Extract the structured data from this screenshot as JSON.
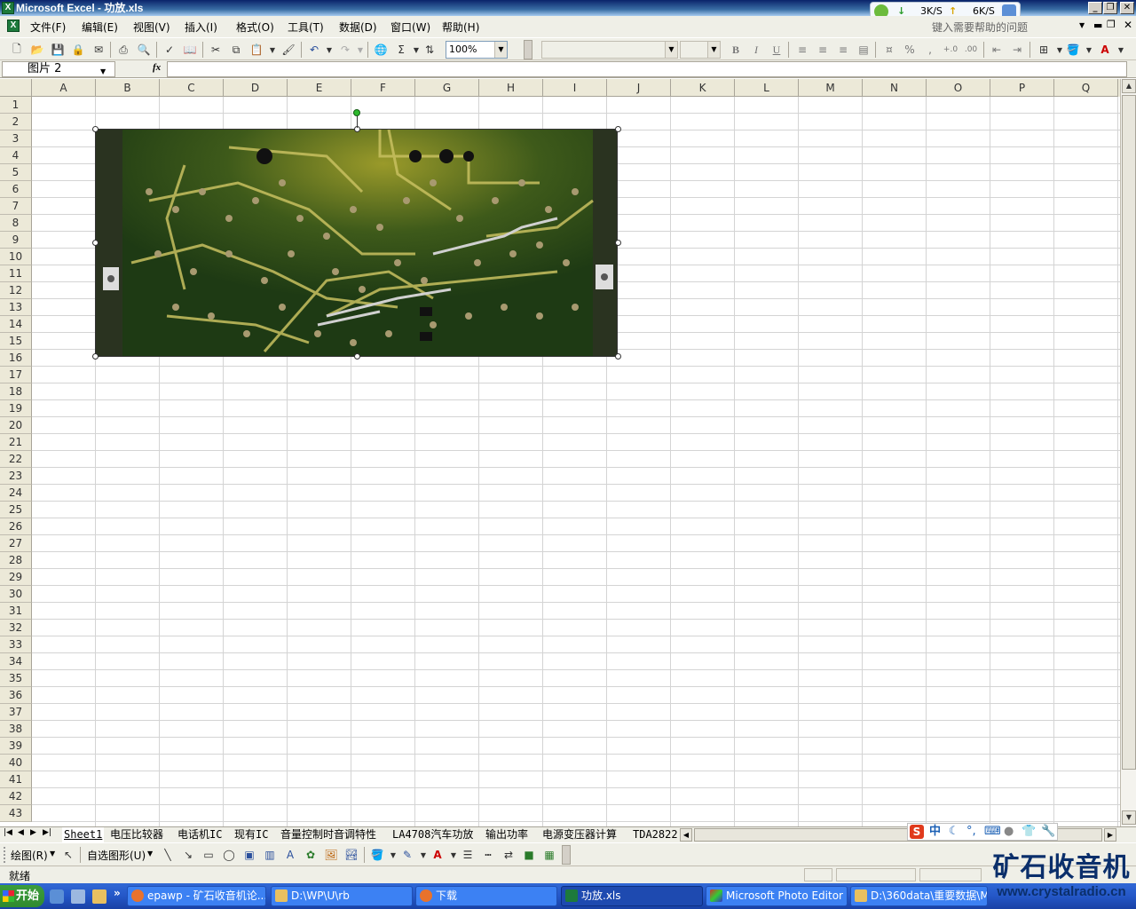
{
  "window": {
    "title": "Microsoft Excel - 功放.xls",
    "app_icon": "excel-icon",
    "buttons": [
      "minimize",
      "restore",
      "close"
    ]
  },
  "menubar": {
    "items": [
      "文件(F)",
      "编辑(E)",
      "视图(V)",
      "插入(I)",
      "格式(O)",
      "工具(T)",
      "数据(D)",
      "窗口(W)",
      "帮助(H)"
    ]
  },
  "netmon": {
    "download": "3K/S",
    "upload": "6K/S"
  },
  "help": {
    "placeholder": "键入需要帮助的问题"
  },
  "toolbar": {
    "zoom": "100%",
    "font_name": "",
    "font_size": ""
  },
  "formula_bar": {
    "name_box": "图片 2",
    "fx": "fx",
    "content": ""
  },
  "grid": {
    "columns": [
      "A",
      "B",
      "C",
      "D",
      "E",
      "F",
      "G",
      "H",
      "I",
      "J",
      "K",
      "L",
      "M",
      "N",
      "O",
      "P",
      "Q"
    ],
    "rows": [
      "1",
      "2",
      "3",
      "4",
      "5",
      "6",
      "7",
      "8",
      "9",
      "10",
      "11",
      "12",
      "13",
      "14",
      "15",
      "16",
      "17",
      "18",
      "19",
      "20",
      "21",
      "22",
      "23",
      "24",
      "25",
      "26",
      "27",
      "28",
      "29",
      "30",
      "31",
      "32",
      "33",
      "34",
      "35",
      "36",
      "37",
      "38",
      "39",
      "40",
      "41",
      "42",
      "43"
    ]
  },
  "picture": {
    "name": "图片 2",
    "subject": "pcb-photo"
  },
  "sheet_tabs": {
    "tabs": [
      "Sheet1",
      "电压比较器",
      "电话机IC",
      "现有IC",
      "音量控制时音调特性",
      "LA4708汽车功放",
      "输出功率",
      "电源变压器计算",
      "TDA2822"
    ],
    "active": "Sheet1"
  },
  "drawbar": {
    "draw": "绘图(R)",
    "autoshapes": "自选图形(U)"
  },
  "status": {
    "text": "就绪"
  },
  "ime": {
    "mode": "中"
  },
  "taskbar": {
    "start": "开始",
    "tasks": [
      {
        "label": "epawp - 矿石收音机论...",
        "icon": "firefox-icon"
      },
      {
        "label": "D:\\WP\\U\\rb",
        "icon": "folder-icon"
      },
      {
        "label": "下载",
        "icon": "firefox-icon"
      },
      {
        "label": "功放.xls",
        "icon": "excel-icon",
        "active": true
      },
      {
        "label": "Microsoft Photo Editor",
        "icon": "photo-editor-icon"
      },
      {
        "label": "D:\\360data\\重要数据\\M...",
        "icon": "folder-icon"
      }
    ]
  },
  "watermark": {
    "cn": "矿石收音机",
    "url": "www.crystalradio.cn"
  },
  "colors": {
    "titlebar": "#0a246a",
    "taskbar": "#2457c7",
    "start": "#2f8a2f",
    "pcb": "#1e3a14"
  }
}
